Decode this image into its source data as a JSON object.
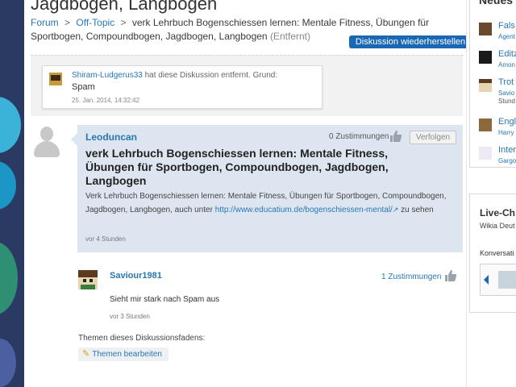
{
  "page": {
    "title": "Jagdbogen, Langbogen",
    "breadcrumb": {
      "forum": "Forum",
      "sep1": ">",
      "offtopic": "Off-Topic",
      "sep2": ">",
      "current": "verk Lehrbuch Bogenschiessen lernen: Mentale Fitness, Übungen für Sportbogen, Compoundbogen, Jagdbogen, Langbogen",
      "status": "(Entfernt)"
    }
  },
  "removed": {
    "user": "Shiram-Ludgerus33",
    "action": "hat diese Diskussion entfernt. Grund:",
    "reason": "Spam",
    "timestamp": "25. Jan. 2014, 14:32:42",
    "restore_label": "Diskussion wiederherstellen"
  },
  "post": {
    "user": "Leoduncan",
    "votes": "0 Zustimmungen",
    "follow_label": "Verfolgen",
    "title": "verk Lehrbuch Bogenschiessen lernen: Mentale Fitness, Übungen für Sportbogen, Compoundbogen, Jagdbogen, Langbogen",
    "body_text": "Verk Lehrbuch Bogenschiessen lernen: Mentale Fitness, Übungen für Sportbogen, Compoundbogen, Jagdbogen, Langbogen, auch unter",
    "link": "http://www.educatium.de/bogenschiessen-mental/",
    "body_suffix": "zu sehen",
    "time": "vor 4 Stunden",
    "thumb_icon": "thumbs-up-icon"
  },
  "reply": {
    "user": "Saviour1981",
    "votes": "1 Zustimmungen",
    "text": "Sieht mir stark nach Spam aus",
    "time": "vor 3 Stunden"
  },
  "tags": {
    "label": "Themen dieses Diskussionsfadens:",
    "edit_label": "Themen bearbeiten",
    "edit_icon": "pencil-icon"
  },
  "rail": {
    "heading": "Neues",
    "items": [
      {
        "title": "Fals",
        "sub": "Agent"
      },
      {
        "title": "Editz",
        "sub": "Amon"
      },
      {
        "title": "Trot",
        "sub": "Savio",
        "sub2": "Stund"
      },
      {
        "title": "Engl",
        "sub": "Harry"
      },
      {
        "title": "Inter",
        "sub": "Gargo"
      }
    ],
    "chat_heading": "Live-Ch",
    "chat_sub": "Wikia Deut",
    "chat_conv": "Konversati"
  },
  "colors": {
    "link": "#2877b5",
    "accent_button": "#1a68b3",
    "post_bg": "#dde6f0"
  }
}
